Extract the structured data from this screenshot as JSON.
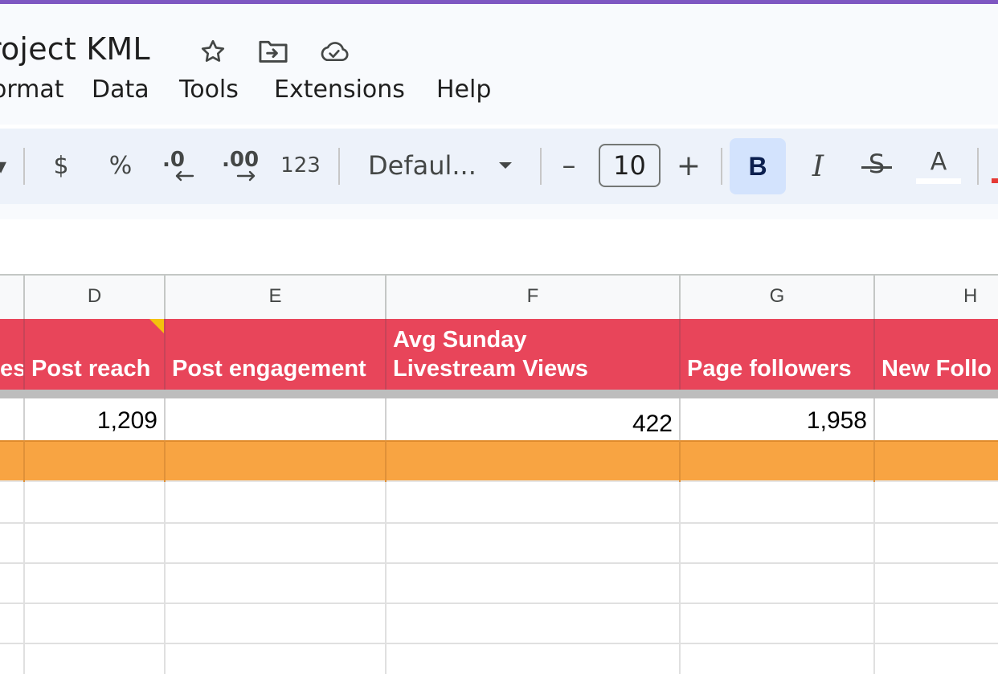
{
  "doc": {
    "title": "roject KML",
    "menu": [
      "ormat",
      "Data",
      "Tools",
      "Extensions",
      "Help"
    ]
  },
  "toolbar": {
    "currency": "$",
    "percent": "%",
    "decrease_decimal": ".0",
    "increase_decimal": ".00",
    "more_formats": "123",
    "font": "Defaul...",
    "font_size": "10",
    "minus": "–",
    "plus": "+",
    "bold": "B",
    "italic": "I",
    "strike": "S",
    "text_color": "A"
  },
  "sheet": {
    "columns": [
      "D",
      "E",
      "F",
      "G",
      "H"
    ],
    "header_row": {
      "c": "es",
      "d": "Post reach",
      "e": "Post engagement",
      "f_line1": "Avg Sunday",
      "f_line2": "Livestream Views",
      "g": "Page followers",
      "h": "New Follo"
    },
    "row1": {
      "d": "1,209",
      "e": "",
      "f": "422",
      "g": "1,958",
      "h": ""
    }
  },
  "colors": {
    "header_red": "#e8455a",
    "orange_row": "#f8a442",
    "bold_active": "#d3e3fd",
    "top_accent": "#7e57c2"
  }
}
